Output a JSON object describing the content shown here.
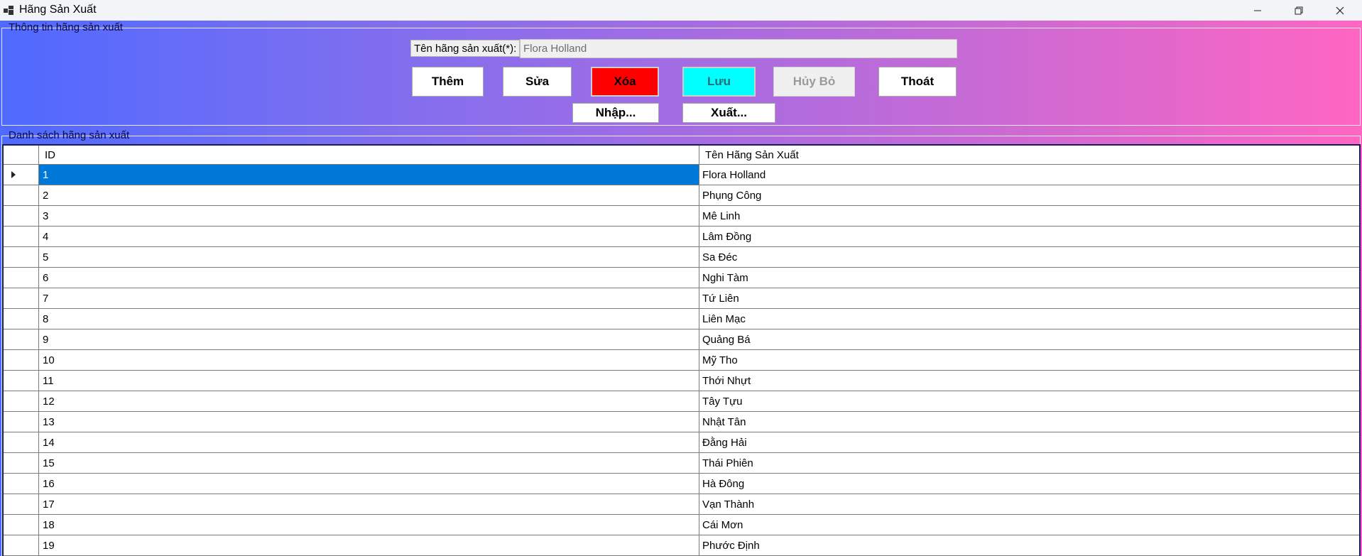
{
  "window": {
    "title": "Hãng Sản Xuất",
    "icon": "app-window-icon",
    "controls": [
      "minimize-icon",
      "maximize-icon",
      "close-icon"
    ]
  },
  "info_group": {
    "legend": "Thông tin hãng sản xuất",
    "name_label": "Tên hãng sản xuất(*):",
    "name_value": "Flora Holland"
  },
  "buttons": {
    "add": "Thêm",
    "edit": "Sửa",
    "delete": "Xóa",
    "save": "Lưu",
    "cancel": "Hủy Bỏ",
    "exit": "Thoát",
    "import": "Nhập...",
    "export": "Xuất..."
  },
  "colors": {
    "delete_bg": "#ff0000",
    "save_bg": "#00ffff",
    "selection": "#0078d7",
    "gradient_start": "#4f6aff",
    "gradient_end": "#ff66c2"
  },
  "list_group": {
    "legend": "Danh sách hãng sản xuất"
  },
  "table": {
    "columns": [
      "ID",
      "Tên Hãng Sản Xuất"
    ],
    "selected_row": 0,
    "rows": [
      [
        "1",
        "Flora Holland"
      ],
      [
        "2",
        "Phụng Công"
      ],
      [
        "3",
        "Mê Linh"
      ],
      [
        "4",
        "Lâm Đồng"
      ],
      [
        "5",
        "Sa Đéc"
      ],
      [
        "6",
        "Nghi Tàm"
      ],
      [
        "7",
        "Tứ Liên"
      ],
      [
        "8",
        "Liên Mạc"
      ],
      [
        "9",
        "Quảng Bá"
      ],
      [
        "10",
        "Mỹ Tho"
      ],
      [
        "11",
        "Thới Nhựt"
      ],
      [
        "12",
        "Tây Tựu"
      ],
      [
        "13",
        "Nhật Tân"
      ],
      [
        "14",
        "Đằng Hải"
      ],
      [
        "15",
        "Thái Phiên"
      ],
      [
        "16",
        "Hà Đông"
      ],
      [
        "17",
        "Vạn Thành"
      ],
      [
        "18",
        "Cái Mơn"
      ],
      [
        "19",
        "Phước Định"
      ]
    ]
  }
}
